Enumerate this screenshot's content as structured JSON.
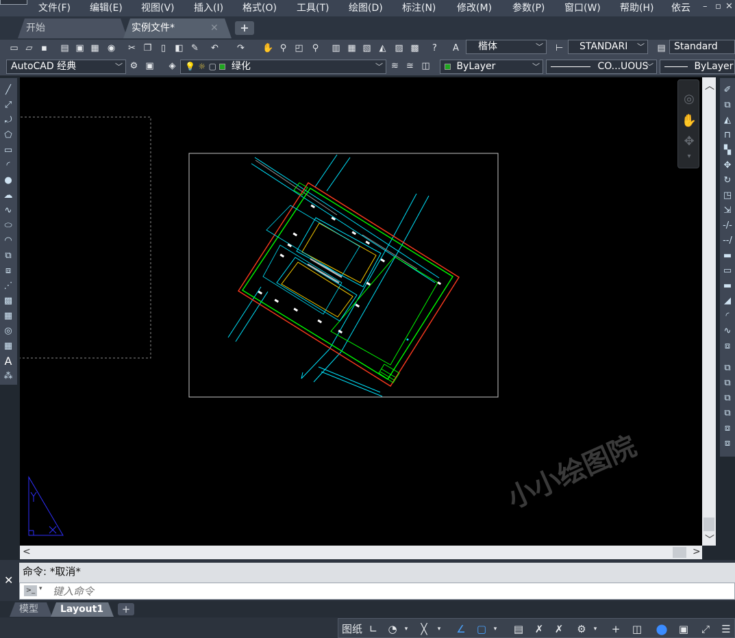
{
  "menu": {
    "items": [
      "文件(F)",
      "编辑(E)",
      "视图(V)",
      "插入(I)",
      "格式(O)",
      "工具(T)",
      "绘图(D)",
      "标注(N)",
      "修改(M)",
      "参数(P)",
      "窗口(W)",
      "帮助(H)",
      "依云"
    ],
    "window_controls": [
      "–",
      "▫",
      "✕"
    ]
  },
  "tabs": {
    "start": "开始",
    "active_file": "实例文件*",
    "close_glyph": "✕",
    "add_glyph": "+"
  },
  "toolbar1": {
    "text_style_font": "楷体",
    "dim_style": "STANDARI",
    "table_style": "Standard"
  },
  "toolbar2": {
    "workspace": "AutoCAD 经典",
    "layer": "绿化",
    "color": "ByLayer",
    "linetype": "CO...UOUS",
    "lineweight": "ByLayer"
  },
  "command": {
    "history": "命令: *取消*",
    "placeholder": "键入命令",
    "close_glyph": "✕"
  },
  "layout_tabs": {
    "model": "模型",
    "layout1": "Layout1",
    "add_glyph": "+"
  },
  "status": {
    "paper_label": "图纸"
  },
  "watermark": "小小绘图院",
  "colors": {
    "canvas": "#000000",
    "cyan_road": "#00e5ff",
    "green_boundary": "#00ff00",
    "red_boundary": "#ff3b1f",
    "yellow_building": "#ffd000",
    "ucs_blue": "#3030ff",
    "layer_green": "#1fa51f"
  }
}
